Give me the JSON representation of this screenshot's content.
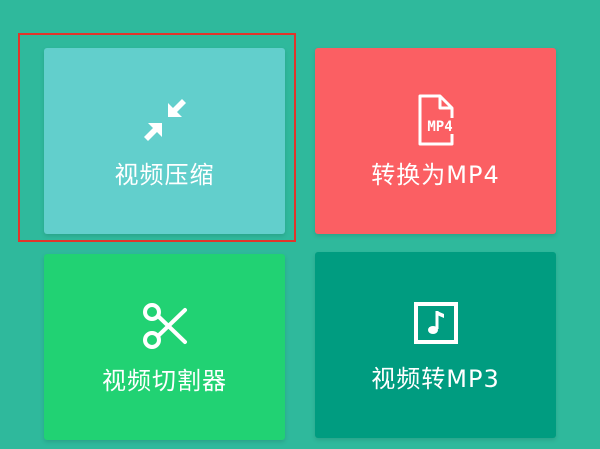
{
  "colors": {
    "background": "#2fb99c",
    "selection_border": "#e1352b"
  },
  "tiles": [
    {
      "label": "视频压缩",
      "icon": "compress-arrows-icon",
      "color": "#62cfcc",
      "selected": true
    },
    {
      "label": "转换为MP4",
      "icon": "mp4-file-icon",
      "color": "#fb5f63",
      "selected": false
    },
    {
      "label": "视频切割器",
      "icon": "scissors-icon",
      "color": "#21d273",
      "selected": false
    },
    {
      "label": "视频转MP3",
      "icon": "music-note-icon",
      "color": "#009c80",
      "selected": false
    }
  ],
  "mp4_icon_text": "MP4"
}
